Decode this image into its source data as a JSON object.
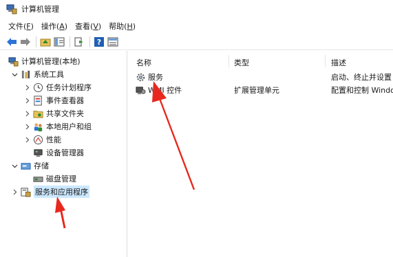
{
  "window": {
    "title": "计算机管理"
  },
  "menu": {
    "file": {
      "label": "文件(",
      "mnemonic": "F",
      "tail": ")"
    },
    "action": {
      "label": "操作(",
      "mnemonic": "A",
      "tail": ")"
    },
    "view": {
      "label": "查看(",
      "mnemonic": "V",
      "tail": ")"
    },
    "help": {
      "label": "帮助(",
      "mnemonic": "H",
      "tail": ")"
    }
  },
  "toolbar": {
    "icons": [
      "back-arrow-icon",
      "forward-arrow-icon",
      "up-folder-icon",
      "show-hide-tree-icon",
      "export-list-icon",
      "help-icon",
      "properties-icon"
    ]
  },
  "tree": {
    "root": "计算机管理(本地)",
    "system_tools": "系统工具",
    "task_scheduler": "任务计划程序",
    "event_viewer": "事件查看器",
    "shared_folders": "共享文件夹",
    "local_users": "本地用户和组",
    "performance": "性能",
    "device_manager": "设备管理器",
    "storage": "存储",
    "disk_management": "磁盘管理",
    "services_apps": "服务和应用程序"
  },
  "list": {
    "columns": {
      "name": "名称",
      "type": "类型",
      "description": "描述"
    },
    "rows": [
      {
        "name": "服务",
        "type": "",
        "description": "启动、终止并设置"
      },
      {
        "name": "WMI 控件",
        "type": "扩展管理单元",
        "description": "配置和控制 Windo"
      }
    ]
  },
  "colors": {
    "selection": "#cce8ff",
    "annotation_arrow": "#e8281e",
    "accent_blue": "#2b73d6"
  }
}
